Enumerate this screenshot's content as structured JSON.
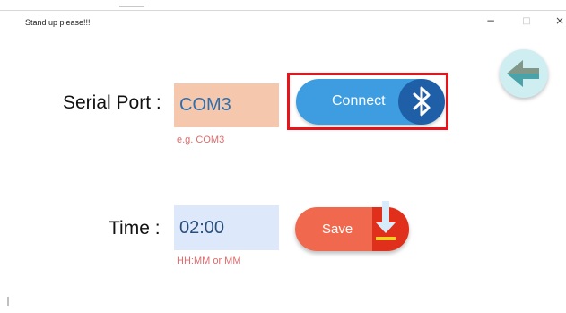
{
  "window": {
    "title": "Stand up please!!!",
    "controls": {
      "minimize": "−",
      "maximize": "□",
      "close": "×"
    }
  },
  "serial_port": {
    "label": "Serial Port :",
    "value": "COM3",
    "hint": "e.g. COM3",
    "connect_label": "Connect"
  },
  "time": {
    "label": "Time :",
    "value": "02:00",
    "hint": "HH:MM or MM",
    "save_label": "Save"
  },
  "icons": [
    "back-arrow-icon",
    "bluetooth-icon",
    "download-icon"
  ],
  "colors": {
    "port_field": "#f5c8ae",
    "time_field": "#dde9fb",
    "connect_button": "#3d9de0",
    "save_button": "#f0694f",
    "hint_text": "#e06a6a",
    "highlight_box": "#e8141a"
  }
}
